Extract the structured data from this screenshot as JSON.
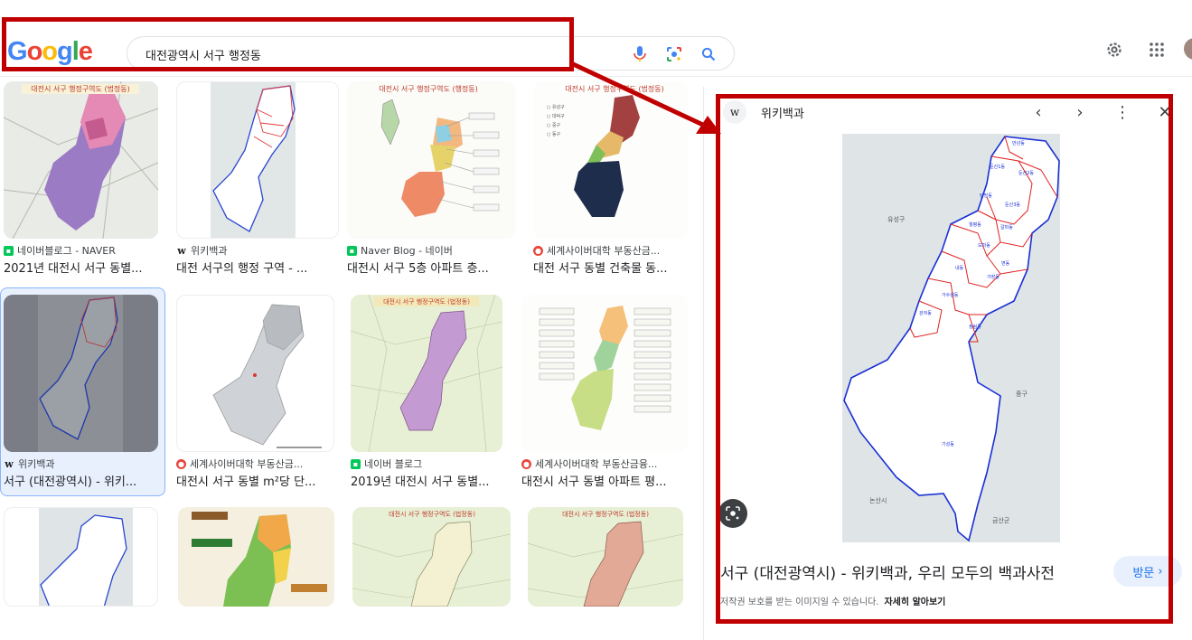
{
  "header": {
    "logo": [
      "G",
      "o",
      "o",
      "g",
      "l",
      "e"
    ],
    "search_value": "대전광역시 서구 행정동"
  },
  "results": [
    {
      "source": "네이버블로그 - NAVER",
      "title": "2021년 대전시 서구 동별...",
      "favicon": "naver"
    },
    {
      "source": "위키백과",
      "title": "대전 서구의 행정 구역 - ...",
      "favicon": "wiki"
    },
    {
      "source": "Naver Blog - 네이버",
      "title": "대전시 서구 5층 아파트 층...",
      "favicon": "naver"
    },
    {
      "source": "세계사이버대학 부동산금...",
      "title": "대전 서구 동별 건축물 동...",
      "favicon": "cyber"
    },
    {
      "source": "위키백과",
      "title": "서구 (대전광역시) - 위키...",
      "favicon": "wiki"
    },
    {
      "source": "세계사이버대학 부동산금...",
      "title": "대전시 서구 동별 m²당 단...",
      "favicon": "cyber"
    },
    {
      "source": "네이버 블로그",
      "title": "2019년 대전시 서구 동별...",
      "favicon": "naver"
    },
    {
      "source": "세계사이버대학 부동산금융...",
      "title": "대전시 서구 동별 아파트 평...",
      "favicon": "cyber"
    }
  ],
  "thumb_headers": {
    "t1": "대전시 서구 행정구역도 (법정동)",
    "t3": "대전시 서구 행정구역도 (행정동)",
    "t4": "대전시 서구 행정구역도 (법정동)",
    "t7": "대전시 서구 행정구역도 (법정동)",
    "t11": "대전시 서구 행정구역도 (법정동)",
    "t12": "대전시 서구 행정구역도 (법정동)"
  },
  "panel": {
    "source": "위키백과",
    "title": "서구 (대전광역시) - 위키백과, 우리 모두의 백과사전",
    "visit_label": "방문",
    "copyright": "저작권 보호를 받는 이미지일 수 있습니다.",
    "learn_more": "자세히 알아보기",
    "map_labels": {
      "left_top": "유성구",
      "right_mid": "중구",
      "bottom_left": "논산시",
      "bottom_right": "금산군",
      "south_district": "기성동"
    }
  },
  "colors": {
    "google_blue": "#4285F4",
    "google_red": "#EA4335",
    "google_yellow": "#FBBC05",
    "google_green": "#34A853",
    "annotation_red": "#c00000"
  }
}
